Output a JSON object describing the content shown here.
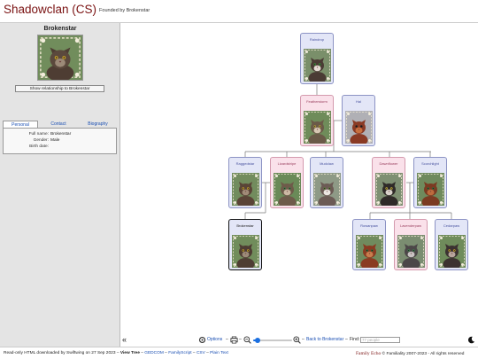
{
  "header": {
    "title": "Shadowclan (CS)",
    "subtitle": "Founded by Brokenstar"
  },
  "sidebar": {
    "person_name": "Brokenstar",
    "relationship_button": "Show relationship to Brokenstar",
    "tabs": [
      "Personal",
      "Contact",
      "Biography"
    ],
    "active_tab": "Personal",
    "fields": [
      {
        "label": "Full name:",
        "value": "Brokenstar"
      },
      {
        "label": "Gender:",
        "value": "Male"
      },
      {
        "label": "Birth date:",
        "value": ""
      }
    ]
  },
  "tree": {
    "cards": [
      {
        "id": "c0",
        "name": "Raindrop",
        "gender": "male",
        "selected": false,
        "colors": {
          "fur": "#4a3b34",
          "face": "#e6dcd5",
          "eye": "#3d8a3a",
          "bg": "#7a8f6a"
        }
      },
      {
        "id": "c1",
        "name": "Featherstorm",
        "gender": "female",
        "selected": false,
        "colors": {
          "fur": "#6b5a48",
          "face": "#d8c7b3",
          "eye": "#b8a23b",
          "bg": "#6f8c5a"
        }
      },
      {
        "id": "c2",
        "name": "Hal",
        "gender": "male",
        "selected": false,
        "colors": {
          "fur": "#8a3a24",
          "face": "#c9703f",
          "eye": "#222",
          "bg": "#b0b0b5"
        }
      },
      {
        "id": "c3",
        "name": "Raggedstar",
        "gender": "male",
        "selected": false,
        "colors": {
          "fur": "#5a4437",
          "face": "#a08b78",
          "eye": "#c7a129",
          "bg": "#728c5e"
        }
      },
      {
        "id": "c4",
        "name": "Lizardstripe",
        "gender": "female",
        "selected": false,
        "colors": {
          "fur": "#6e5b4a",
          "face": "#cdb9a4",
          "eye": "#3e7a47",
          "bg": "#6a8a58"
        }
      },
      {
        "id": "c5",
        "name": "Mudclaw",
        "gender": "male",
        "selected": false,
        "colors": {
          "fur": "#6c5b55",
          "face": "#ece7e2",
          "eye": "#5a7a3a",
          "bg": "#8e9a86"
        }
      },
      {
        "id": "c6",
        "name": "Dawnflower",
        "gender": "female",
        "selected": false,
        "colors": {
          "fur": "#2f2a28",
          "face": "#d9d2cb",
          "eye": "#c9b237",
          "bg": "#7e8f72"
        }
      },
      {
        "id": "c7",
        "name": "Scorchlight",
        "gender": "male",
        "selected": false,
        "colors": {
          "fur": "#7b3b22",
          "face": "#bd6b3d",
          "eye": "#2f6b3a",
          "bg": "#6f8a5d"
        }
      },
      {
        "id": "c8",
        "name": "Brokenstar",
        "gender": "male",
        "selected": true,
        "colors": {
          "fur": "#4e3d33",
          "face": "#9c8a78",
          "eye": "#c7a129",
          "bg": "#718d5c"
        }
      },
      {
        "id": "c9",
        "name": "Rowanpaw",
        "gender": "male",
        "selected": false,
        "colors": {
          "fur": "#8a3b22",
          "face": "#c97e4e",
          "eye": "#2f6b3a",
          "bg": "#708b5e"
        }
      },
      {
        "id": "c10",
        "name": "Lavenderpaw",
        "gender": "female",
        "selected": false,
        "colors": {
          "fur": "#4c4748",
          "face": "#c9c3c3",
          "eye": "#3a7a4a",
          "bg": "#7b8d71"
        }
      },
      {
        "id": "c11",
        "name": "Cedarpaw",
        "gender": "male",
        "selected": false,
        "colors": {
          "fur": "#3c3231",
          "face": "#b8a69d",
          "eye": "#c7a129",
          "bg": "#6f8c5b"
        }
      }
    ]
  },
  "toolbar": {
    "options_label": "Options",
    "back_label": "Back to Brokenstar",
    "find_label": "Find:",
    "find_placeholder": "77 people",
    "dash": "–",
    "slider_value": 0.12
  },
  "footer": {
    "left_text": "Read-only HTML downloaded by Swiftwing on 27 Sep 2023 –",
    "view_tree": "View Tree",
    "links": [
      "GEDCOM",
      "FamilyScript",
      "CSV",
      "Plain Text"
    ],
    "sep": "–",
    "brand": "Family Echo",
    "copyright": "© Familiality 2007-2023 - All rights reserved"
  },
  "colors": {
    "title": "#7a1212",
    "link": "#1a4fb3",
    "male_card": "#e3e6f7",
    "female_card": "#fae1ea"
  }
}
